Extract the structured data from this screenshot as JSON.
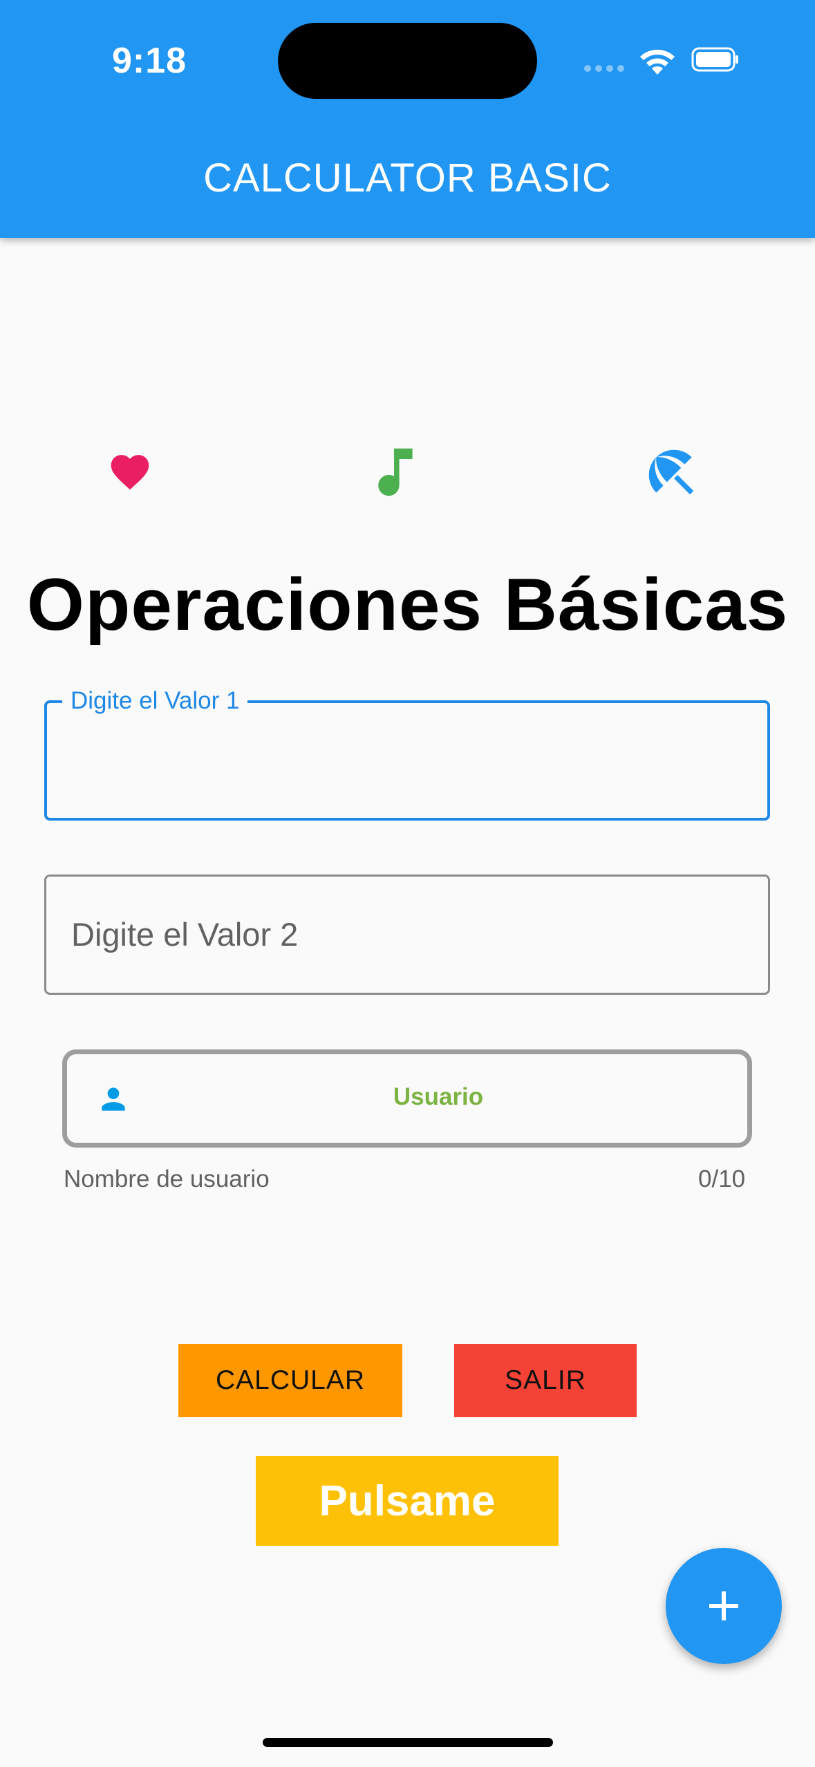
{
  "status_bar": {
    "time": "9:18"
  },
  "app_bar": {
    "title": "CALCULATOR BASIC",
    "color": "#2196f3"
  },
  "icons_row": [
    {
      "icon": "heart-icon",
      "color": "#e91e63"
    },
    {
      "icon": "music-note-icon",
      "color": "#4caf50"
    },
    {
      "icon": "beach-umbrella-icon",
      "color": "#2196f3"
    }
  ],
  "heading": "Operaciones Básicas",
  "form": {
    "value1": {
      "label": "Digite el Valor 1",
      "value": ""
    },
    "value2": {
      "placeholder": "Digite el Valor 2",
      "value": ""
    },
    "username": {
      "hint": "Usuario",
      "icon": "person-icon",
      "helper": "Nombre de usuario",
      "counter": "0/10"
    }
  },
  "buttons": {
    "calculate": "CALCULAR",
    "exit": "SALIR",
    "press_me": "Pulsame"
  },
  "fab": {
    "icon": "plus-icon",
    "label": "+"
  }
}
